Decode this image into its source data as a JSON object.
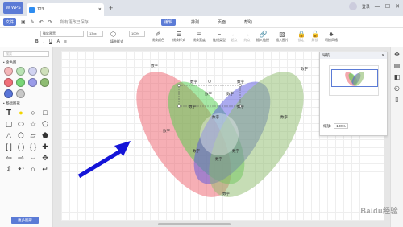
{
  "titlebar": {
    "wps_label": "WPS",
    "doc_name": "123",
    "user": "登录"
  },
  "menubar": {
    "file_label": "文件",
    "saved_text": "所有更改已保存",
    "menus": [
      "编辑",
      "排列",
      "页面",
      "帮助"
    ]
  },
  "toolbar": {
    "font_name": "微软雅黑",
    "font_size": "13px",
    "zoom": "100%",
    "buttons": [
      "填充样式",
      "线条颜色",
      "线条样式",
      "线条宽度",
      "连线类型",
      "起点",
      "终点",
      "插入链接",
      "插入图片",
      "锁定",
      "解锁",
      "切换风格"
    ]
  },
  "leftpanel": {
    "search_placeholder": "搜索",
    "section_colors": "• 涂色图",
    "section_basic": "• 基础图形",
    "more_shapes": "更多图形"
  },
  "colors": [
    "#f4b6b8",
    "#b9e3b4",
    "#d1d3f1",
    "#cfe0bb",
    "#f06e78",
    "#79d677",
    "#9a9be9",
    "#8ebc72",
    "#5874d8",
    "#c8c8c8"
  ],
  "navigator": {
    "title": "导航",
    "zoom_label": "缩放:",
    "zoom_value": "100%"
  },
  "venn": {
    "label": "数字"
  },
  "watermark": "Baidu经验"
}
